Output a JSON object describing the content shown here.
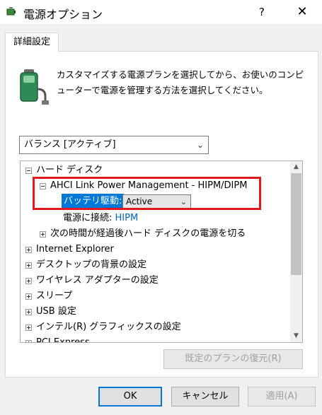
{
  "window": {
    "title": "電源オプション",
    "help_label": "?",
    "close_label": "✕"
  },
  "tab": {
    "label": "詳細設定"
  },
  "description": "カスタマイズする電源プランを選択してから、お使いのコンピューターで電源を管理する方法を選択してください。",
  "plan_select": {
    "value": "バランス [アクティブ]"
  },
  "tree": {
    "hard_disk": "ハード ディスク",
    "ahci": "AHCI Link Power Management - HIPM/DIPM",
    "battery_label": "バッテリ駆動:",
    "battery_value": "Active",
    "plugged_label": "電源に接続:",
    "plugged_value": "HIPM",
    "turn_off_hd": "次の時間が経過後ハード ディスクの電源を切る",
    "items": [
      "Internet Explorer",
      "デスクトップの背景の設定",
      "ワイヤレス アダプターの設定",
      "スリープ",
      "USB 設定",
      "インテル(R) グラフィックスの設定",
      "PCI Express"
    ]
  },
  "buttons": {
    "restore": "既定のプランの復元(R)",
    "ok": "OK",
    "cancel": "キャンセル",
    "apply": "適用(A)"
  },
  "colors": {
    "selection": "#0078d7",
    "highlight_box": "#e0191f",
    "link": "#0066cc"
  }
}
